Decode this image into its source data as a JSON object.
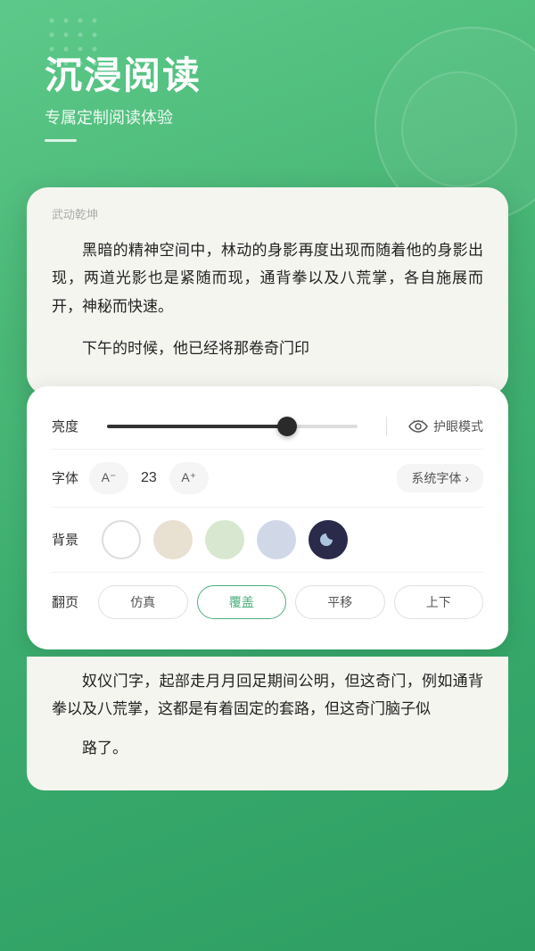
{
  "background": {
    "color": "#4caf7d"
  },
  "header": {
    "title": "沉浸阅读",
    "subtitle": "专属定制阅读体验"
  },
  "reading_card": {
    "book_title": "武动乾坤",
    "paragraphs": [
      "黑暗的精神空间中，林动的身影再度出现而随着他的身影出现，两道光影也是紧随而现，通背拳以及八荒掌，各自施展而开，神秘而快速。",
      "下午的时候，他已经将那卷奇门印"
    ]
  },
  "settings": {
    "brightness_label": "亮度",
    "brightness_value": 72,
    "eye_mode_label": "护眼模式",
    "font_label": "字体",
    "font_decrease": "A⁻",
    "font_size": "23",
    "font_increase": "A⁺",
    "font_type": "系统字体",
    "font_type_arrow": "›",
    "bg_label": "背景",
    "page_label": "翻页",
    "page_options": [
      {
        "label": "仿真",
        "active": false
      },
      {
        "label": "覆盖",
        "active": true
      },
      {
        "label": "平移",
        "active": false
      },
      {
        "label": "上下",
        "active": false
      }
    ]
  },
  "bottom_reading": {
    "paragraphs": [
      "奴仪门字，起部走月月回足期间公明，但这奇门，例如通背拳以及八荒掌，这都是有着固定的套路，但这奇门脑子似",
      "路了。"
    ]
  }
}
